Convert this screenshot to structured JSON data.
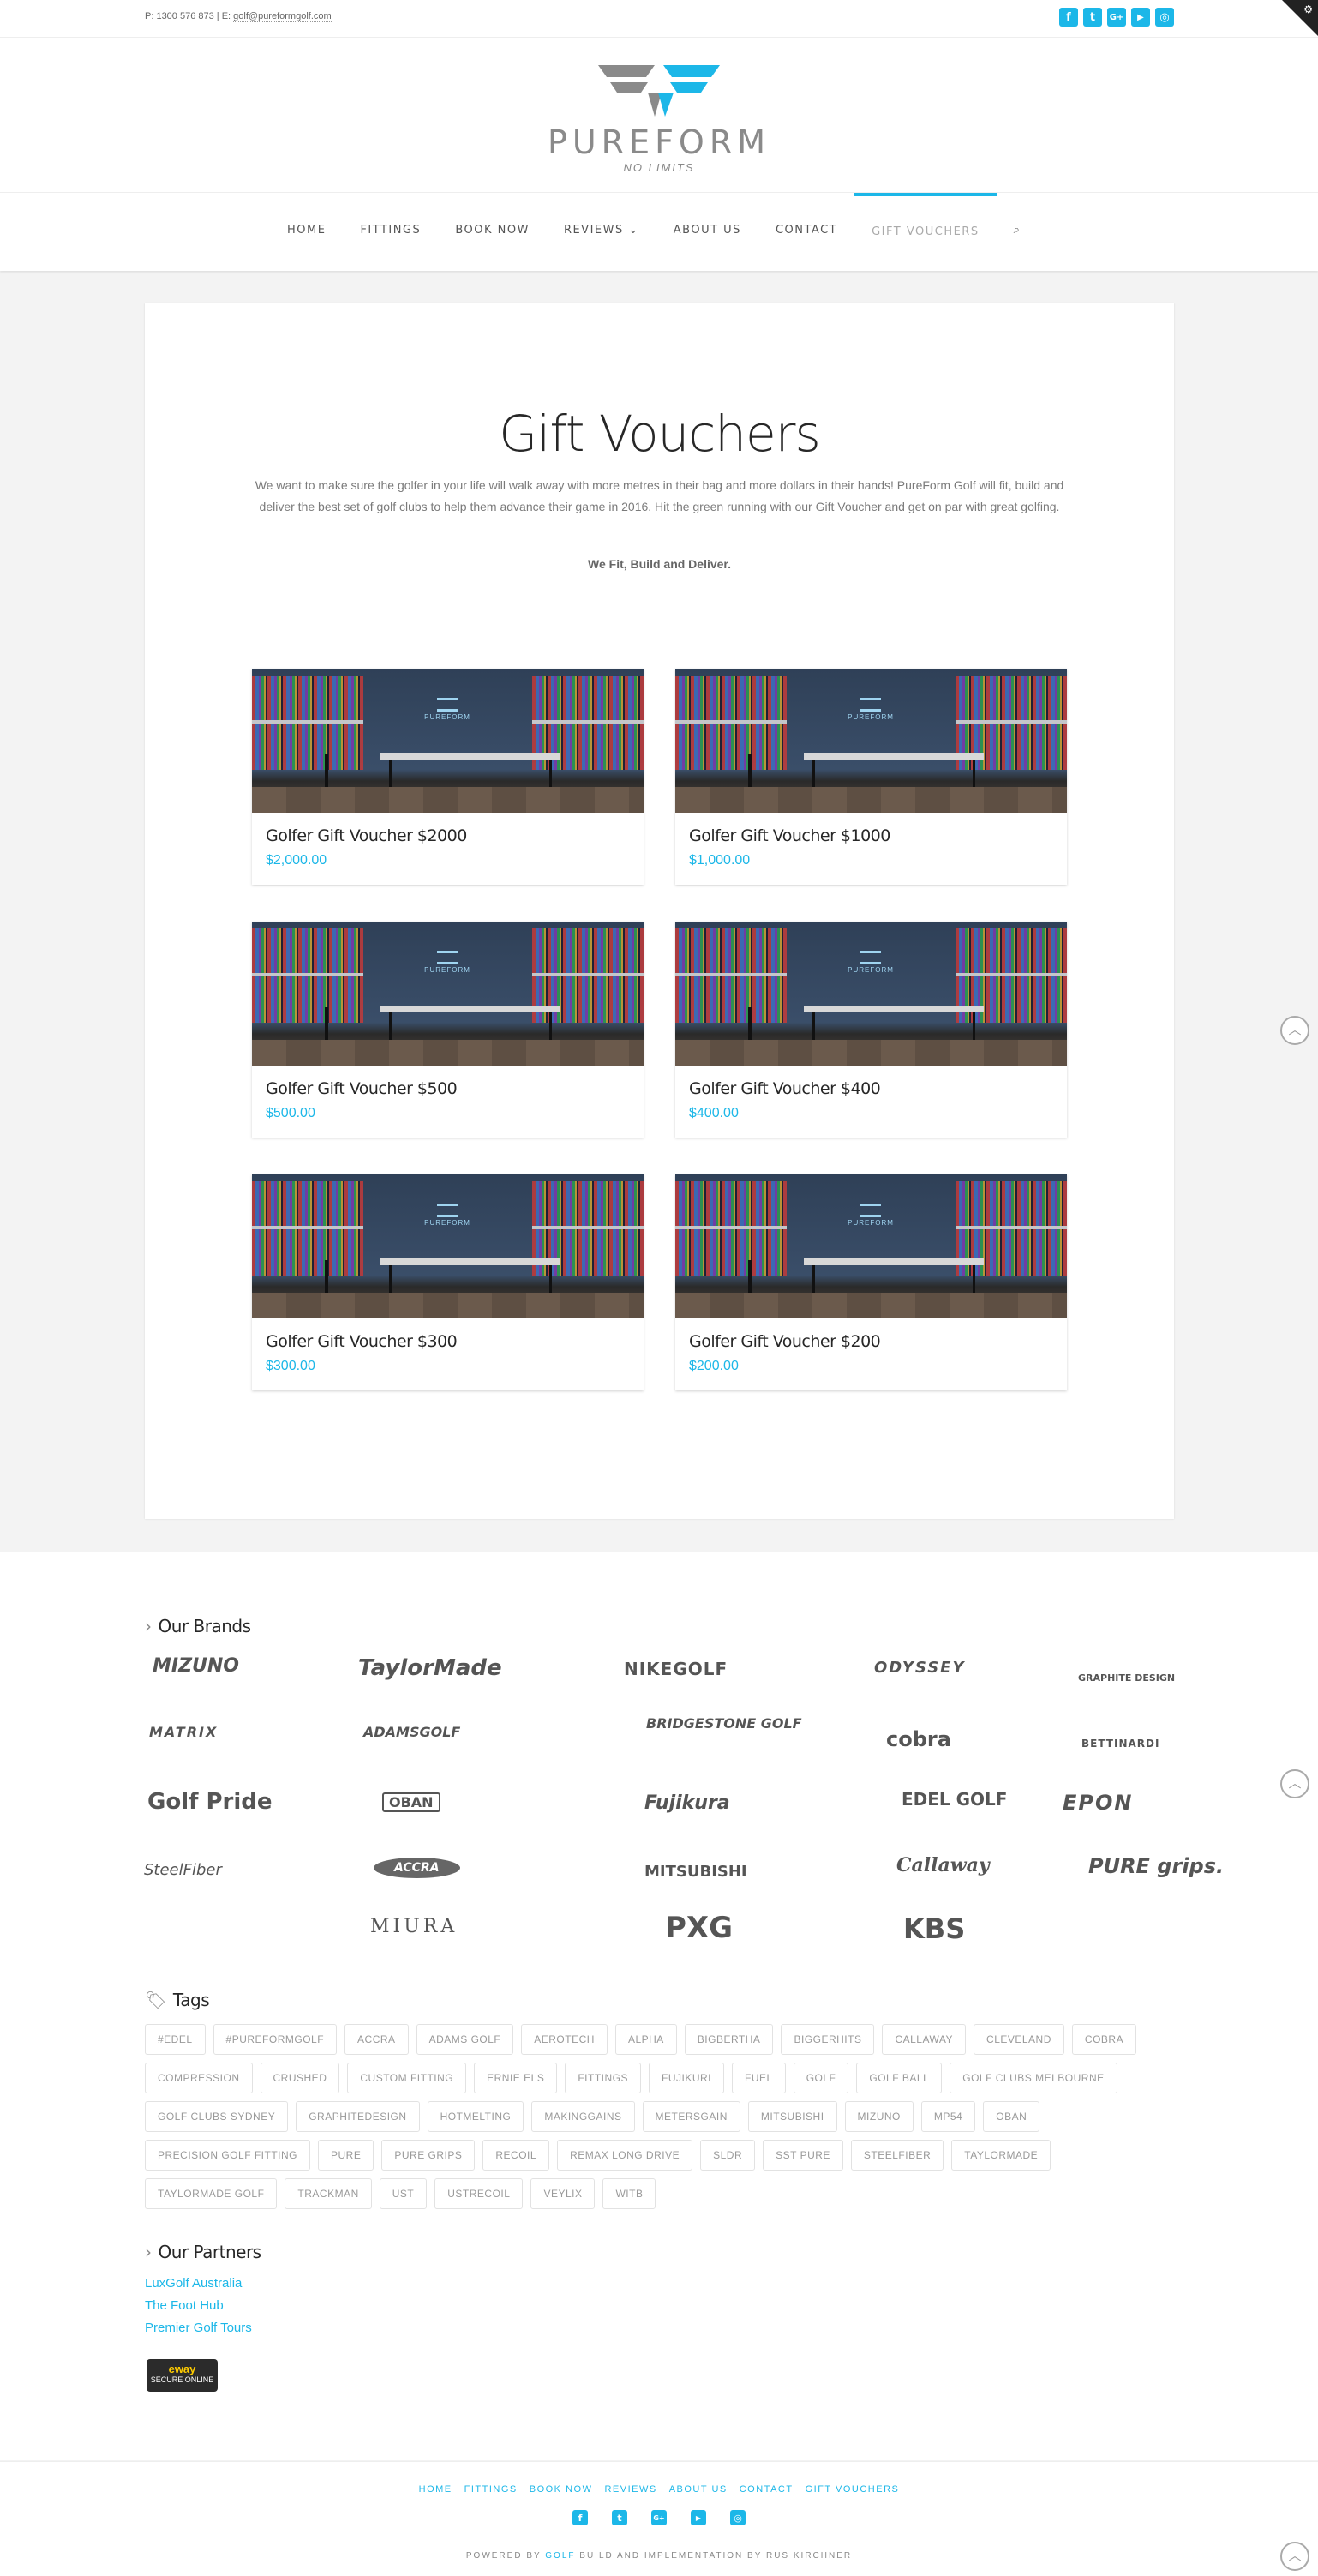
{
  "topbar": {
    "contact_text": "P: 1300 576 873 | E: ",
    "email": "golf@pureformgolf.com",
    "socials": [
      {
        "icon": "facebook-icon",
        "glyph": "f"
      },
      {
        "icon": "twitter-icon",
        "glyph": "t"
      },
      {
        "icon": "google-plus-icon",
        "glyph": "G+"
      },
      {
        "icon": "youtube-icon",
        "glyph": "▶"
      },
      {
        "icon": "instagram-icon",
        "glyph": "◎"
      }
    ],
    "corner_icon": "gear-icon"
  },
  "logo": {
    "word": "PUREFORM",
    "tagline": "NO LIMITS",
    "colors": {
      "grey": "#8a8a8a",
      "blue": "#1cb7e8"
    }
  },
  "nav": {
    "items": [
      "HOME",
      "FITTINGS",
      "BOOK NOW",
      "REVIEWS ⌄",
      "ABOUT US",
      "CONTACT",
      "GIFT VOUCHERS"
    ],
    "active": "GIFT VOUCHERS",
    "search_icon": "search-icon"
  },
  "page": {
    "title": "Gift Vouchers",
    "intro": "We want to make sure the golfer in your life will walk away with more metres in their bag and more dollars in their hands! PureForm Golf will fit, build and deliver the best set of golf clubs to help them advance their game in 2016. Hit the green running with our Gift Voucher and get on par with great golfing.",
    "tagline": "We Fit, Build and Deliver."
  },
  "products": [
    {
      "title": "Golfer Gift Voucher $2000",
      "price": "$2,000.00"
    },
    {
      "title": "Golfer Gift Voucher $1000",
      "price": "$1,000.00"
    },
    {
      "title": "Golfer Gift Voucher $500",
      "price": "$500.00"
    },
    {
      "title": "Golfer Gift Voucher $400",
      "price": "$400.00"
    },
    {
      "title": "Golfer Gift Voucher $300",
      "price": "$300.00"
    },
    {
      "title": "Golfer Gift Voucher $200",
      "price": "$200.00"
    }
  ],
  "brands": {
    "title": "Our Brands",
    "items": [
      "MIZUNO",
      "TaylorMade",
      "NIKEGOLF",
      "ODYSSEY",
      "GRAPHITE DESIGN",
      "MATRIX",
      "ADAMSGOLF",
      "BRIDGESTONE GOLF",
      "cobra",
      "BETTINARDI",
      "Golf Pride",
      "OBAN",
      "Fujikura",
      "EDEL GOLF",
      "EPON",
      "SteelFiber",
      "ACCRA",
      "MITSUBISHI",
      "Callaway",
      "PURE grips.",
      "MIURA",
      "PXG",
      "KBS"
    ]
  },
  "tags": {
    "title": "Tags",
    "items": [
      "#EDEL",
      "#PUREFORMGOLF",
      "ACCRA",
      "ADAMS GOLF",
      "AEROTECH",
      "ALPHA",
      "BIGBERTHA",
      "BIGGERHITS",
      "CALLAWAY",
      "CLEVELAND",
      "COBRA",
      "COMPRESSION",
      "CRUSHED",
      "CUSTOM FITTING",
      "ERNIE ELS",
      "FITTINGS",
      "FUJIKURI",
      "FUEL",
      "GOLF",
      "GOLF BALL",
      "GOLF CLUBS MELBOURNE",
      "GOLF CLUBS SYDNEY",
      "GRAPHITEDESIGN",
      "HOTMELTING",
      "MAKINGGAINS",
      "METERSGAIN",
      "MITSUBISHI",
      "MIZUNO",
      "MP54",
      "OBAN",
      "PRECISION GOLF FITTING",
      "PURE",
      "PURE GRIPS",
      "RECOIL",
      "REMAX LONG DRIVE",
      "SLDR",
      "SST PURE",
      "STEELFIBER",
      "TAYLORMADE",
      "TAYLORMADE GOLF",
      "TRACKMAN",
      "UST",
      "USTRECOIL",
      "VEYLIX",
      "WITB"
    ]
  },
  "partners": {
    "title": "Our Partners",
    "items": [
      "LuxGolf Australia",
      "The Foot Hub",
      "Premier Golf Tours"
    ]
  },
  "eway": {
    "brand": "eway",
    "label": "SECURE ONLINE"
  },
  "footer": {
    "nav": [
      "HOME",
      "FITTINGS",
      "BOOK NOW",
      "REVIEWS",
      "ABOUT US",
      "CONTACT",
      "GIFT VOUCHERS"
    ],
    "credit_pre": "POWERED BY ",
    "credit_link": "GOLF",
    "credit_post": " BUILD AND IMPLEMENTATION BY RUS KIRCHNER"
  },
  "back_to_top_icon": "chevron-up-icon"
}
